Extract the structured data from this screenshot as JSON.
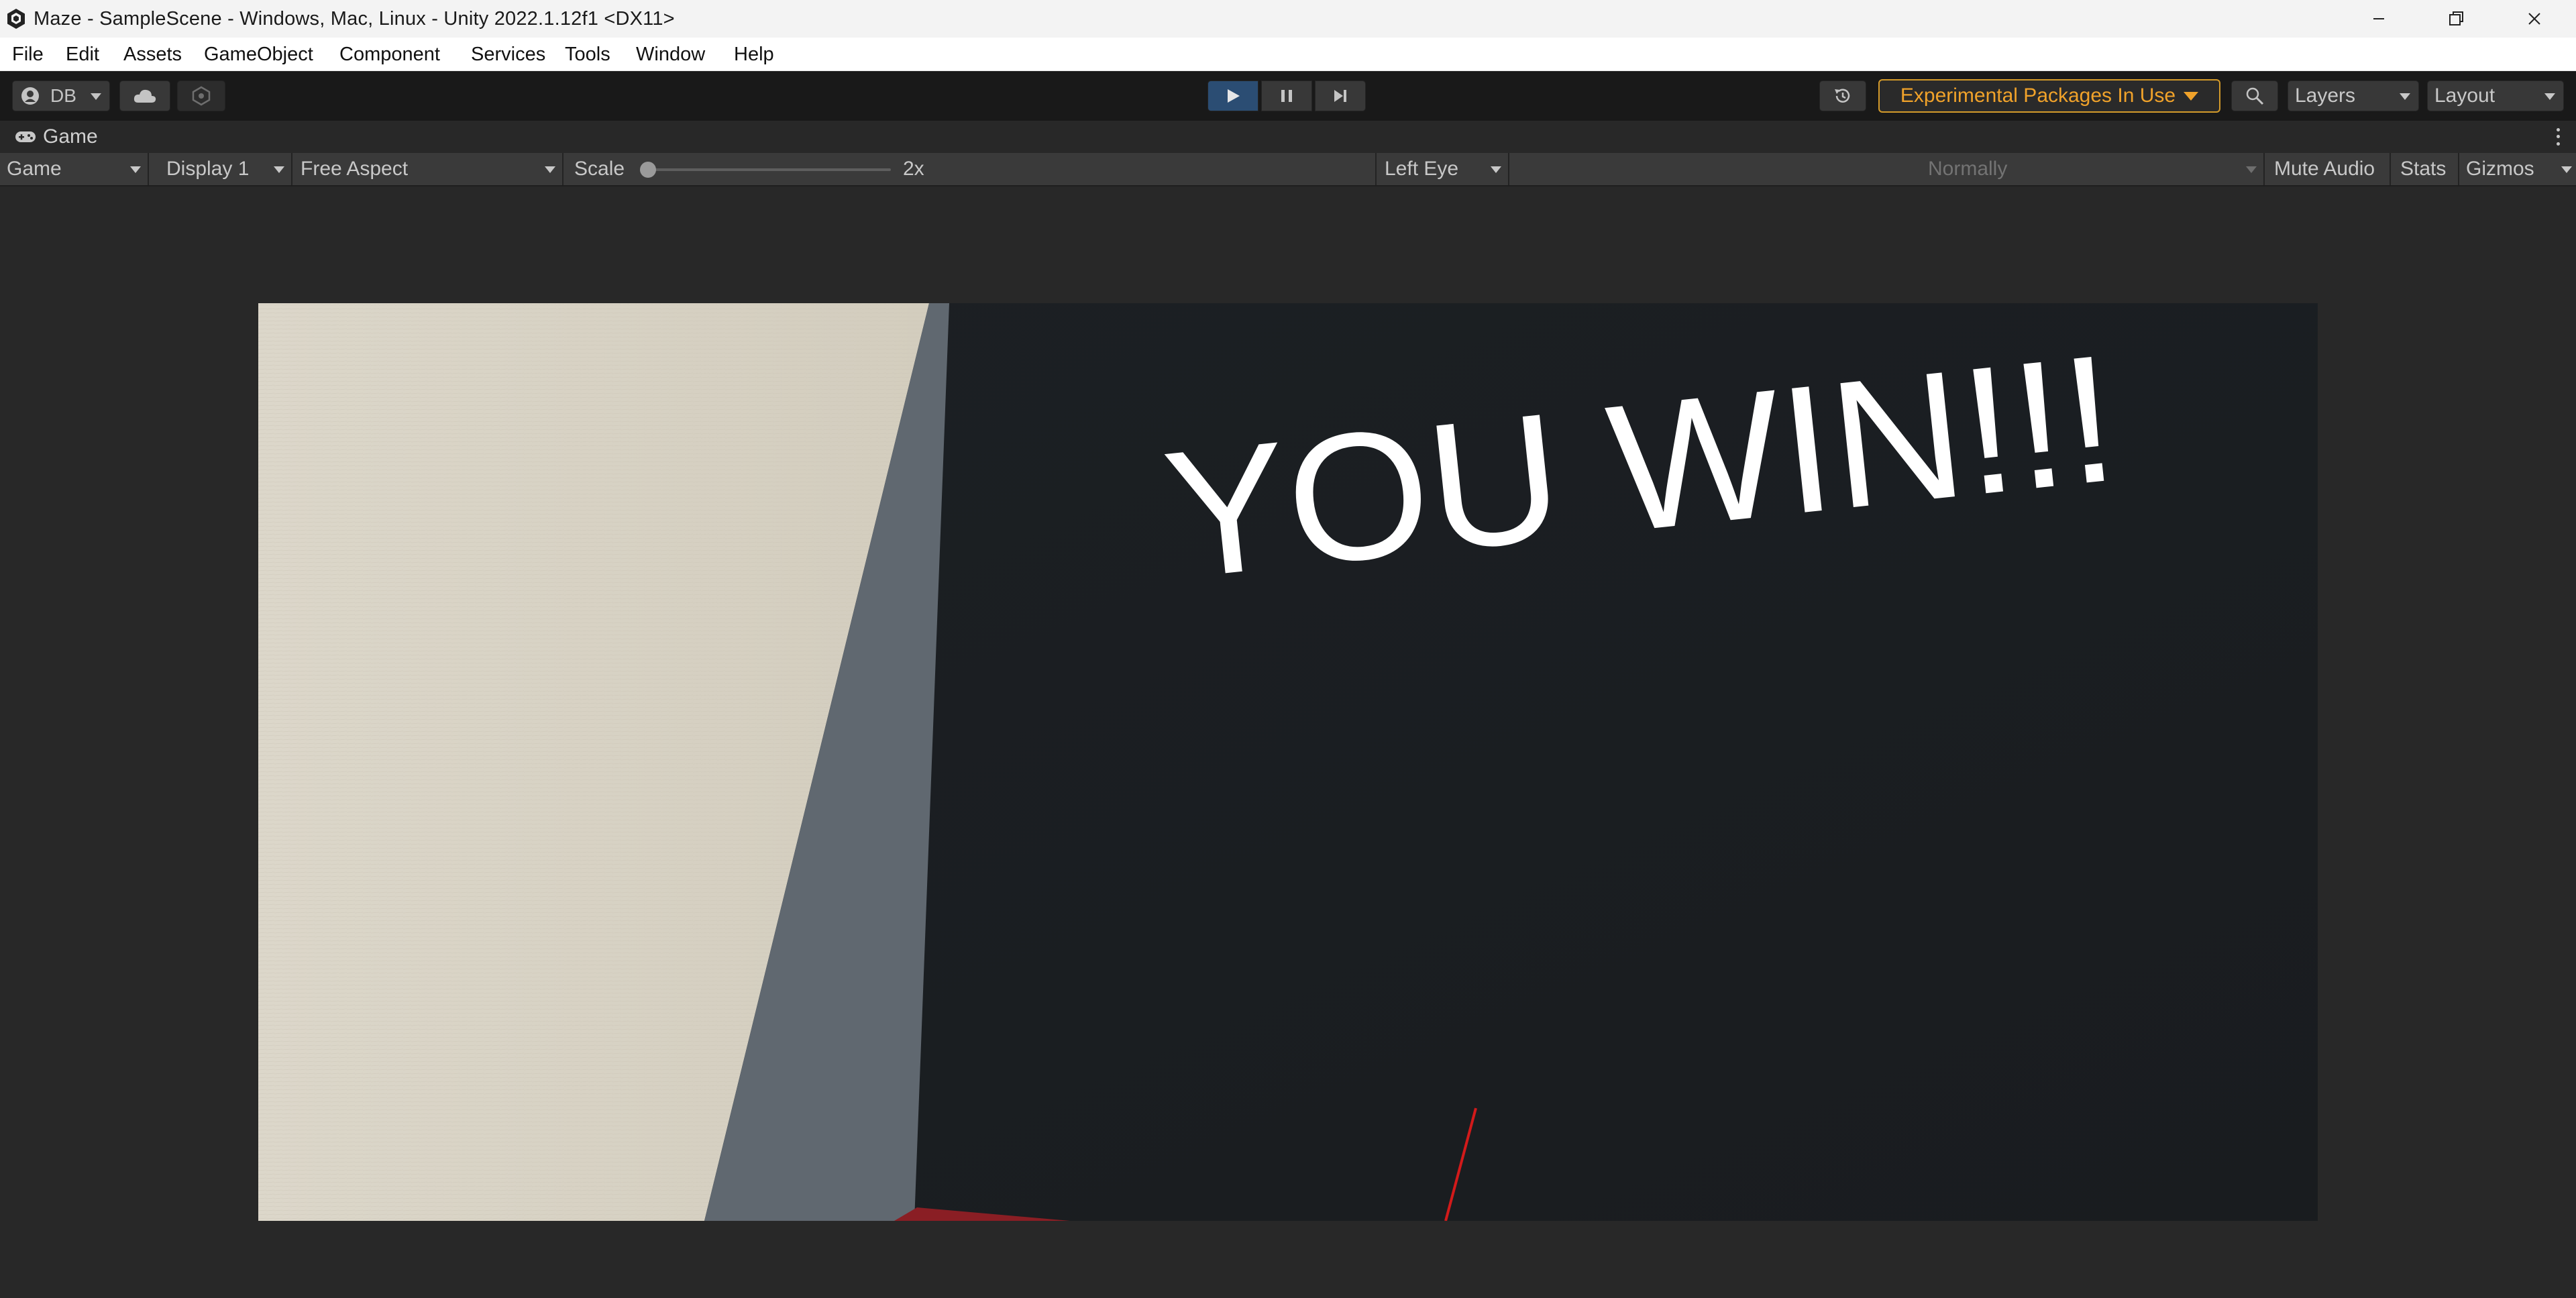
{
  "window": {
    "title": "Maze - SampleScene - Windows, Mac, Linux - Unity 2022.1.12f1 <DX11>",
    "app_icon": "unity-logo-icon",
    "controls": [
      "minimize-icon",
      "restore-icon",
      "close-icon"
    ]
  },
  "menubar": {
    "items": [
      "File",
      "Edit",
      "Assets",
      "GameObject",
      "Component",
      "Services",
      "Tools",
      "Window",
      "Help"
    ]
  },
  "toolbar": {
    "account_label": "DB",
    "experimental_label": "Experimental Packages In Use",
    "layers_label": "Layers",
    "layout_label": "Layout",
    "accent_color": "#f0a22a",
    "play_active": true
  },
  "tab": {
    "label": "Game"
  },
  "gameview": {
    "mode": "Game",
    "display": "Display 1",
    "aspect": "Free Aspect",
    "scale_label": "Scale",
    "scale_value": "2x",
    "scale_level": 0.0,
    "eye": "Left Eye",
    "blend": "Normally",
    "mute_audio": "Mute Audio",
    "stats": "Stats",
    "gizmos": "Gizmos"
  },
  "scene": {
    "win_text": "YOU WIN!!!"
  }
}
